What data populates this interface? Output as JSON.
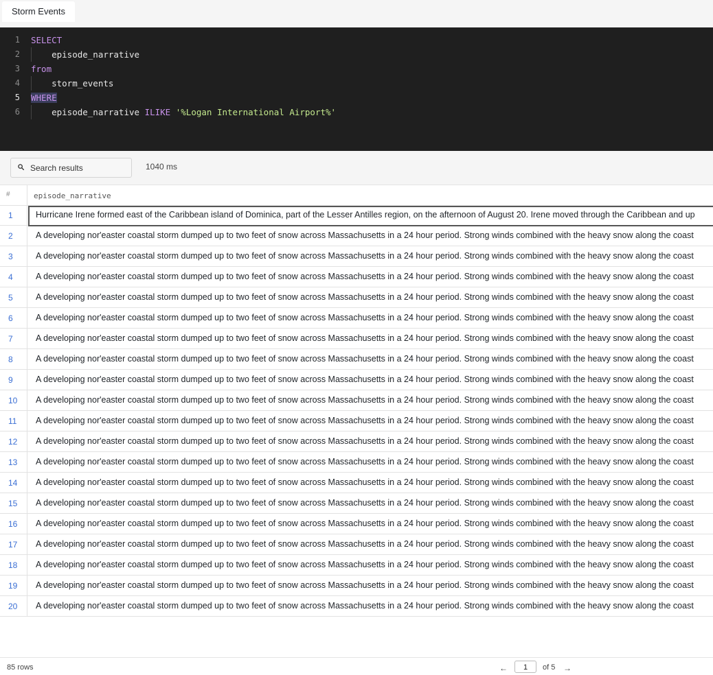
{
  "tab": {
    "title": "Storm Events"
  },
  "editor": {
    "lines": [
      {
        "n": "1",
        "parts": [
          {
            "t": "SELECT",
            "c": "kw"
          }
        ]
      },
      {
        "n": "2",
        "parts": [
          {
            "t": "    episode_narrative",
            "c": ""
          }
        ]
      },
      {
        "n": "3",
        "parts": [
          {
            "t": "from",
            "c": "kw"
          }
        ]
      },
      {
        "n": "4",
        "parts": [
          {
            "t": "    storm_events",
            "c": ""
          }
        ]
      },
      {
        "n": "5",
        "parts": [
          {
            "t": "WHERE",
            "c": "kw-hl"
          }
        ],
        "active": true
      },
      {
        "n": "6",
        "parts": [
          {
            "t": "    episode_narrative ",
            "c": ""
          },
          {
            "t": "ILIKE",
            "c": "kw"
          },
          {
            "t": " ",
            "c": ""
          },
          {
            "t": "'%Logan International Airport%'",
            "c": "str"
          }
        ]
      }
    ]
  },
  "search": {
    "placeholder": "Search results",
    "timing": "1040 ms"
  },
  "table": {
    "num_header": "#",
    "column": "episode_narrative",
    "rows": [
      "Hurricane Irene formed east of the Caribbean island of Dominica, part of the Lesser Antilles region, on the afternoon of August 20. Irene moved through the Caribbean and up",
      "A developing nor'easter coastal storm dumped up to two feet of snow across Massachusetts in a 24 hour period. Strong winds combined with the heavy snow along the coast",
      "A developing nor'easter coastal storm dumped up to two feet of snow across Massachusetts in a 24 hour period. Strong winds combined with the heavy snow along the coast",
      "A developing nor'easter coastal storm dumped up to two feet of snow across Massachusetts in a 24 hour period. Strong winds combined with the heavy snow along the coast",
      "A developing nor'easter coastal storm dumped up to two feet of snow across Massachusetts in a 24 hour period. Strong winds combined with the heavy snow along the coast",
      "A developing nor'easter coastal storm dumped up to two feet of snow across Massachusetts in a 24 hour period. Strong winds combined with the heavy snow along the coast",
      "A developing nor'easter coastal storm dumped up to two feet of snow across Massachusetts in a 24 hour period. Strong winds combined with the heavy snow along the coast",
      "A developing nor'easter coastal storm dumped up to two feet of snow across Massachusetts in a 24 hour period. Strong winds combined with the heavy snow along the coast",
      "A developing nor'easter coastal storm dumped up to two feet of snow across Massachusetts in a 24 hour period. Strong winds combined with the heavy snow along the coast",
      "A developing nor'easter coastal storm dumped up to two feet of snow across Massachusetts in a 24 hour period. Strong winds combined with the heavy snow along the coast",
      "A developing nor'easter coastal storm dumped up to two feet of snow across Massachusetts in a 24 hour period. Strong winds combined with the heavy snow along the coast",
      "A developing nor'easter coastal storm dumped up to two feet of snow across Massachusetts in a 24 hour period. Strong winds combined with the heavy snow along the coast",
      "A developing nor'easter coastal storm dumped up to two feet of snow across Massachusetts in a 24 hour period. Strong winds combined with the heavy snow along the coast",
      "A developing nor'easter coastal storm dumped up to two feet of snow across Massachusetts in a 24 hour period. Strong winds combined with the heavy snow along the coast",
      "A developing nor'easter coastal storm dumped up to two feet of snow across Massachusetts in a 24 hour period. Strong winds combined with the heavy snow along the coast",
      "A developing nor'easter coastal storm dumped up to two feet of snow across Massachusetts in a 24 hour period. Strong winds combined with the heavy snow along the coast",
      "A developing nor'easter coastal storm dumped up to two feet of snow across Massachusetts in a 24 hour period. Strong winds combined with the heavy snow along the coast",
      "A developing nor'easter coastal storm dumped up to two feet of snow across Massachusetts in a 24 hour period. Strong winds combined with the heavy snow along the coast",
      "A developing nor'easter coastal storm dumped up to two feet of snow across Massachusetts in a 24 hour period. Strong winds combined with the heavy snow along the coast",
      "A developing nor'easter coastal storm dumped up to two feet of snow across Massachusetts in a 24 hour period. Strong winds combined with the heavy snow along the coast"
    ],
    "selected_row": 1
  },
  "footer": {
    "row_count": "85 rows",
    "prev_icon": "arrow-left-icon",
    "next_icon": "arrow-right-icon",
    "prev_glyph": "←",
    "next_glyph": "→",
    "page": "1",
    "of_label": "of 5"
  }
}
